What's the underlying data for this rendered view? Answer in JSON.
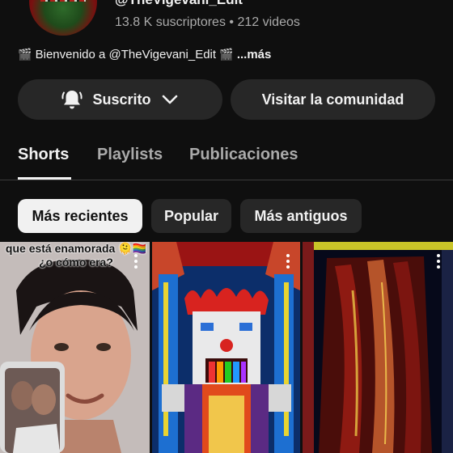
{
  "channel": {
    "handle": "@TheVigevani_Edit",
    "subscribers": "13.8 K suscriptores",
    "separator": "•",
    "videos": "212 videos",
    "welcome_text": "Bienvenido a @TheVigevani_Edit",
    "more_label": "...más"
  },
  "actions": {
    "subscribe_label": "Suscrito",
    "community_label": "Visitar la comunidad"
  },
  "tabs": [
    {
      "label": "Shorts",
      "active": true
    },
    {
      "label": "Playlists",
      "active": false
    },
    {
      "label": "Publicaciones",
      "active": false
    }
  ],
  "filters": [
    {
      "label": "Más recientes",
      "active": true
    },
    {
      "label": "Popular",
      "active": false
    },
    {
      "label": "Más antiguos",
      "active": false
    }
  ],
  "shorts": [
    {
      "caption": "que está enamorada 🫠🏳️‍🌈 ¿o cómo era?"
    },
    {
      "caption": ""
    },
    {
      "caption": ""
    }
  ],
  "colors": {
    "background": "#0f0f0f",
    "button_bg": "#272727",
    "text_primary": "#f1f1f1",
    "text_secondary": "#aaaaaa",
    "chip_active_bg": "#f1f1f1"
  },
  "icons": [
    "bell-icon",
    "chevron-down-icon",
    "clapperboard-icon",
    "more-vert-icon"
  ]
}
